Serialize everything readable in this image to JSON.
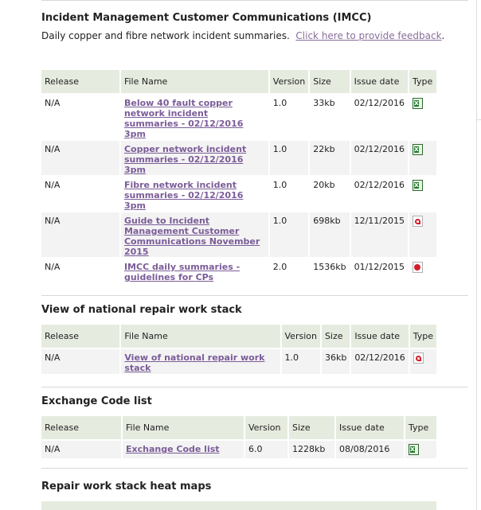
{
  "imcc": {
    "title": "Incident Management Customer Communications (IMCC)",
    "description": "Daily copper and fibre network incident summaries.",
    "feedback_link": "Click here to provide feedback",
    "headers": [
      "Release",
      "File Name",
      "Version",
      "Size",
      "Issue date",
      "Type"
    ],
    "rows": [
      {
        "release": "N/A",
        "name": "Below 40 fault copper network incident summaries - 02/12/2016 3pm",
        "version": "1.0",
        "size": "33kb",
        "date": "02/12/2016",
        "type": "excel-icon"
      },
      {
        "release": "N/A",
        "name": "Copper network incident summaries - 02/12/2016 3pm",
        "version": "1.0",
        "size": "22kb",
        "date": "02/12/2016",
        "type": "excel-icon"
      },
      {
        "release": "N/A",
        "name": "Fibre network incident summaries - 02/12/2016 3pm",
        "version": "1.0",
        "size": "20kb",
        "date": "02/12/2016",
        "type": "excel-icon"
      },
      {
        "release": "N/A",
        "name": "Guide to Incident Management Customer Communications November 2015",
        "version": "1.0",
        "size": "698kb",
        "date": "12/11/2015",
        "type": "pdf-icon"
      },
      {
        "release": "N/A",
        "name": "IMCC daily summaries - guidelines for CPs",
        "version": "2.0",
        "size": "1536kb",
        "date": "01/12/2015",
        "type": "powerpoint-icon"
      }
    ]
  },
  "repair_stack": {
    "title": "View of national repair work stack",
    "headers": [
      "Release",
      "File Name",
      "Version",
      "Size",
      "Issue date",
      "Type"
    ],
    "rows": [
      {
        "release": "N/A",
        "name": "View of national repair work stack",
        "version": "1.0",
        "size": "36kb",
        "date": "02/12/2016",
        "type": "pdf-icon"
      }
    ]
  },
  "exchange": {
    "title": "Exchange Code list",
    "headers": [
      "Release",
      "File Name",
      "Version",
      "Size",
      "Issue date",
      "Type"
    ],
    "rows": [
      {
        "release": "N/A",
        "name": "Exchange Code list",
        "version": "6.0",
        "size": "1228kb",
        "date": "08/08/2016",
        "type": "excel-icon"
      }
    ]
  },
  "heatmaps": {
    "title": "Repair work stack heat maps"
  }
}
